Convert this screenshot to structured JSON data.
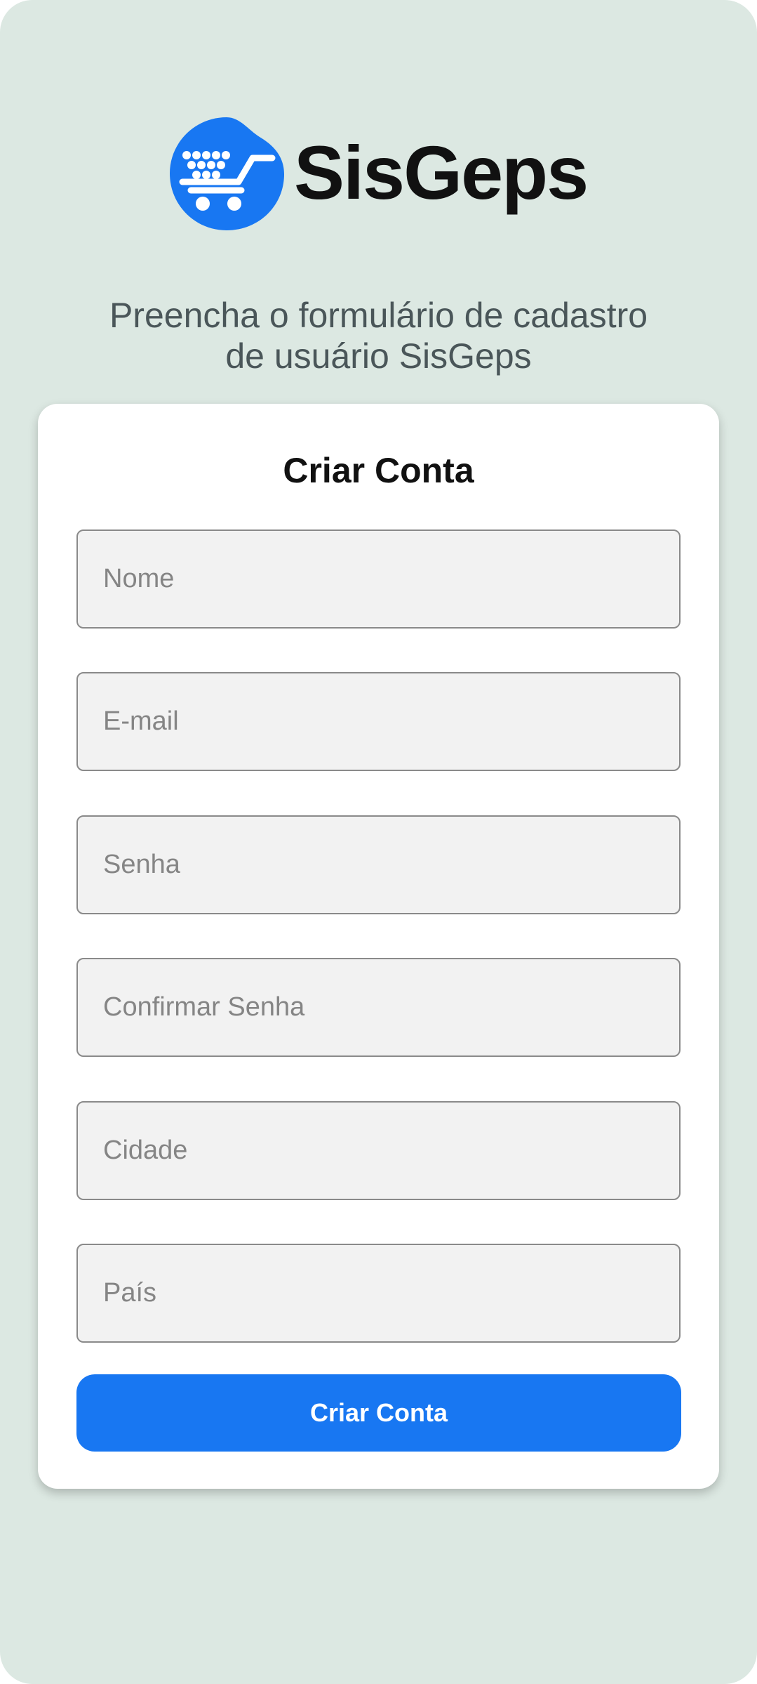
{
  "brand": {
    "name": "SisGeps",
    "logo_icon": "shopping-cart-icon",
    "accent_color": "#1877f2"
  },
  "subtitle": {
    "line1": "Preencha o formulário de cadastro",
    "line2": "de usuário SisGeps"
  },
  "form": {
    "title": "Criar Conta",
    "fields": [
      {
        "placeholder": "Nome",
        "value": ""
      },
      {
        "placeholder": "E-mail",
        "value": ""
      },
      {
        "placeholder": "Senha",
        "value": ""
      },
      {
        "placeholder": "Confirmar Senha",
        "value": ""
      },
      {
        "placeholder": "Cidade",
        "value": ""
      },
      {
        "placeholder": "País",
        "value": ""
      }
    ],
    "submit_label": "Criar Conta"
  },
  "colors": {
    "background": "#dce8e2",
    "card": "#ffffff",
    "button": "#1877f2"
  }
}
